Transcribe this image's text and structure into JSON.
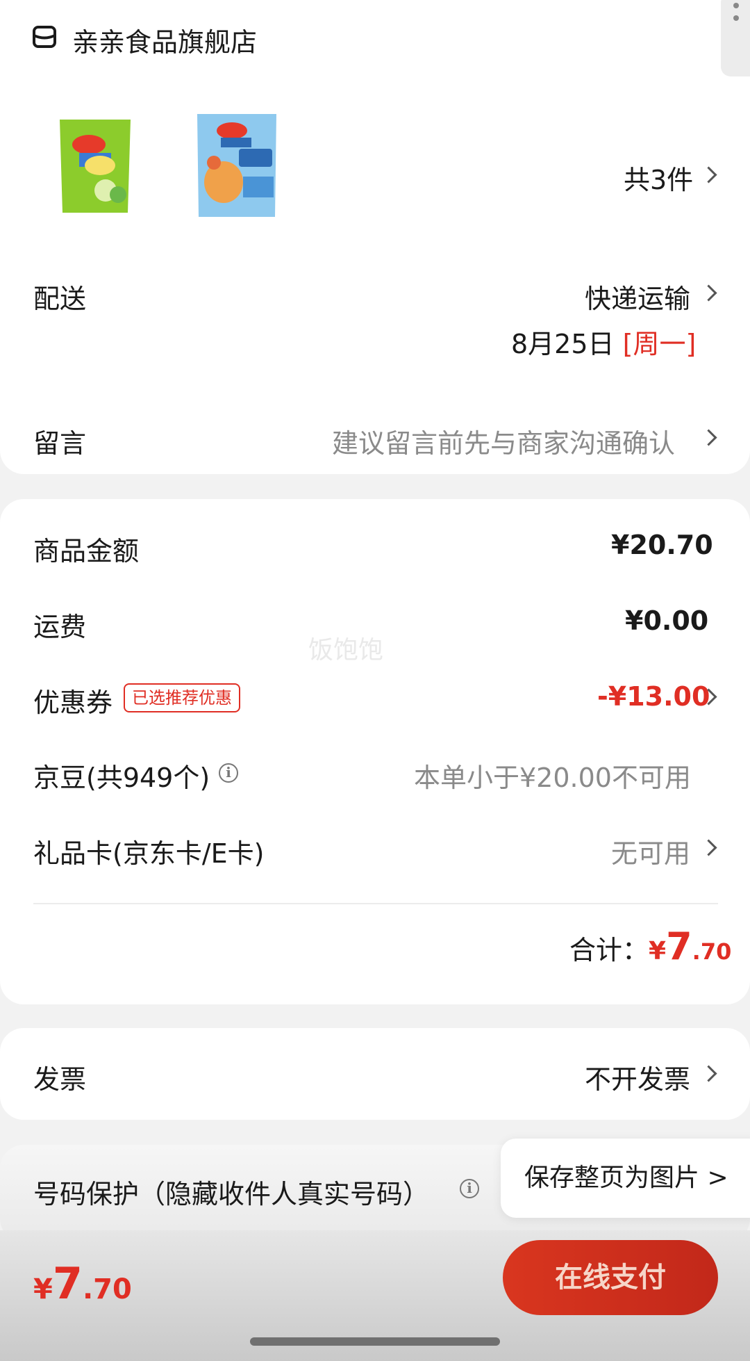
{
  "store": {
    "name": "亲亲食品旗舰店",
    "icon": "store-icon"
  },
  "products": {
    "count_label": "共3件"
  },
  "delivery": {
    "label": "配送",
    "method": "快递运输",
    "date": "8月25日",
    "weekday": "[周一]"
  },
  "message": {
    "label": "留言",
    "placeholder": "建议留言前先与商家沟通确认"
  },
  "price": {
    "goods_label": "商品金额",
    "goods_value": "¥20.70",
    "shipping_label": "运费",
    "shipping_value": "¥0.00",
    "coupon_label": "优惠券",
    "coupon_badge": "已选推荐优惠",
    "coupon_value": "-¥13.00",
    "jingdou_label": "京豆(共949个)",
    "jingdou_value": "本单小于¥20.00不可用",
    "giftcard_label": "礼品卡(京东卡/E卡)",
    "giftcard_value": "无可用",
    "total_label": "合计：",
    "total_symbol": "¥",
    "total_int": "7",
    "total_dec": ".70"
  },
  "watermark": "饭饱饱",
  "invoice": {
    "label": "发票",
    "value": "不开发票"
  },
  "privacy": {
    "label": "号码保护（隐藏收件人真实号码）"
  },
  "tooltip": {
    "label": "保存整页为图片 >"
  },
  "footer": {
    "symbol": "¥",
    "int": "7",
    "dec": ".70",
    "pay_label": "在线支付"
  },
  "colors": {
    "accent": "#e02e24",
    "pay_button": "#d9361f"
  }
}
